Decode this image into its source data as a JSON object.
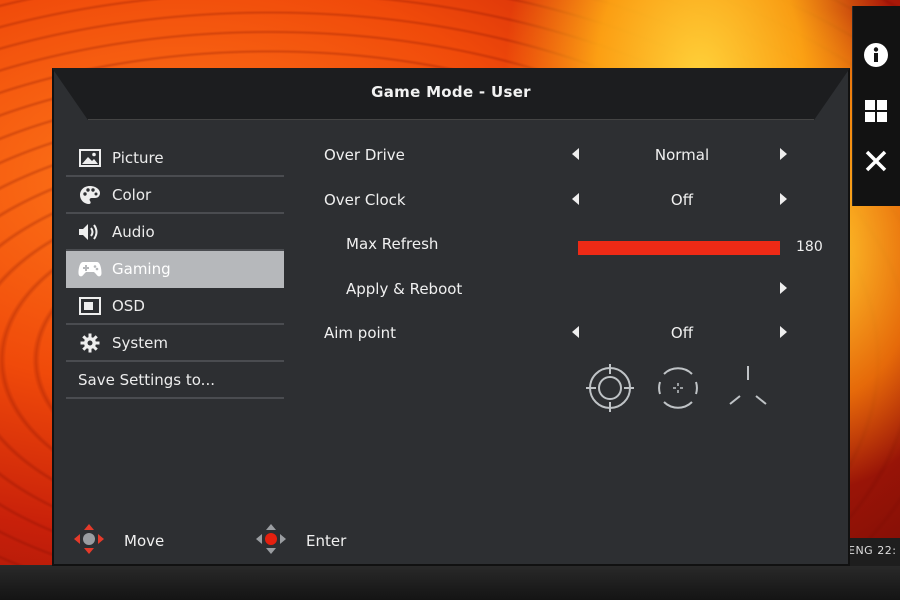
{
  "osd": {
    "title": "Game Mode - User",
    "sidebar": [
      {
        "label": "Picture",
        "icon": "picture-icon"
      },
      {
        "label": "Color",
        "icon": "palette-icon"
      },
      {
        "label": "Audio",
        "icon": "speaker-icon"
      },
      {
        "label": "Gaming",
        "icon": "gamepad-icon",
        "active": true
      },
      {
        "label": "OSD",
        "icon": "osd-icon"
      },
      {
        "label": "System",
        "icon": "gear-icon"
      },
      {
        "label": "Save Settings to..."
      }
    ],
    "settings": {
      "over_drive": {
        "label": "Over Drive",
        "value": "Normal"
      },
      "over_clock": {
        "label": "Over Clock",
        "value": "Off"
      },
      "max_refresh": {
        "label": "Max Refresh",
        "value": "180",
        "level_fraction": 1.0
      },
      "apply_reboot": {
        "label": "Apply & Reboot"
      },
      "aim_point": {
        "label": "Aim point",
        "value": "Off",
        "options": [
          "crosshair-icon-1",
          "crosshair-icon-2",
          "crosshair-icon-3"
        ]
      }
    },
    "footer": {
      "move": "Move",
      "enter": "Enter"
    }
  },
  "quick_panel": [
    "info-icon",
    "grid-icon",
    "close-icon"
  ],
  "taskbar": {
    "text": "ENG  22:"
  },
  "colors": {
    "accent": "#ee2a16",
    "active_tab": "#b6b8bb",
    "panel_bg": "#2d2f32"
  }
}
